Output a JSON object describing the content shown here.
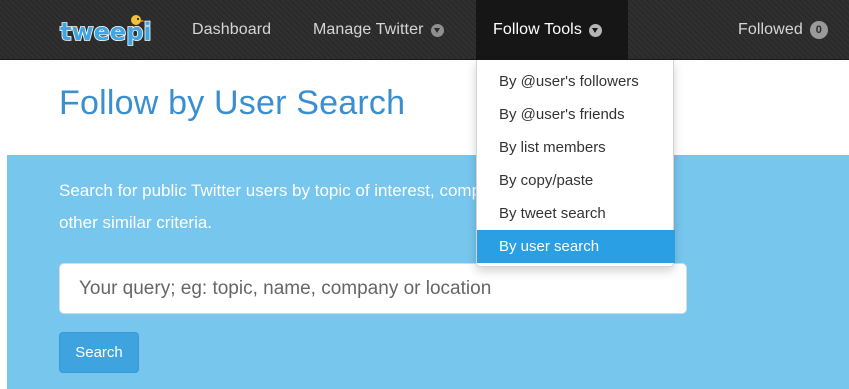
{
  "logo": {
    "text": "tweepi"
  },
  "nav": {
    "dashboard": "Dashboard",
    "manage_twitter": "Manage Twitter",
    "follow_tools": "Follow Tools",
    "followed_label": "Followed",
    "followed_count": "0"
  },
  "dropdown": {
    "items": [
      {
        "label": "By @user's followers"
      },
      {
        "label": "By @user's friends"
      },
      {
        "label": "By list members"
      },
      {
        "label": "By copy/paste"
      },
      {
        "label": "By tweet search"
      },
      {
        "label": "By user search",
        "active": true
      }
    ]
  },
  "page": {
    "title": "Follow by User Search"
  },
  "search": {
    "description": "Search for public Twitter users by topic of interest, company name, location, or other similar criteria.",
    "placeholder": "Your query; eg: topic, name, company or location",
    "value": "",
    "button_label": "Search"
  },
  "colors": {
    "navbar": "#2b2b2b",
    "title": "#3a8fd1",
    "panel": "#76c6ee",
    "active_item": "#2a9fe3",
    "button": "#3fa3e0"
  }
}
